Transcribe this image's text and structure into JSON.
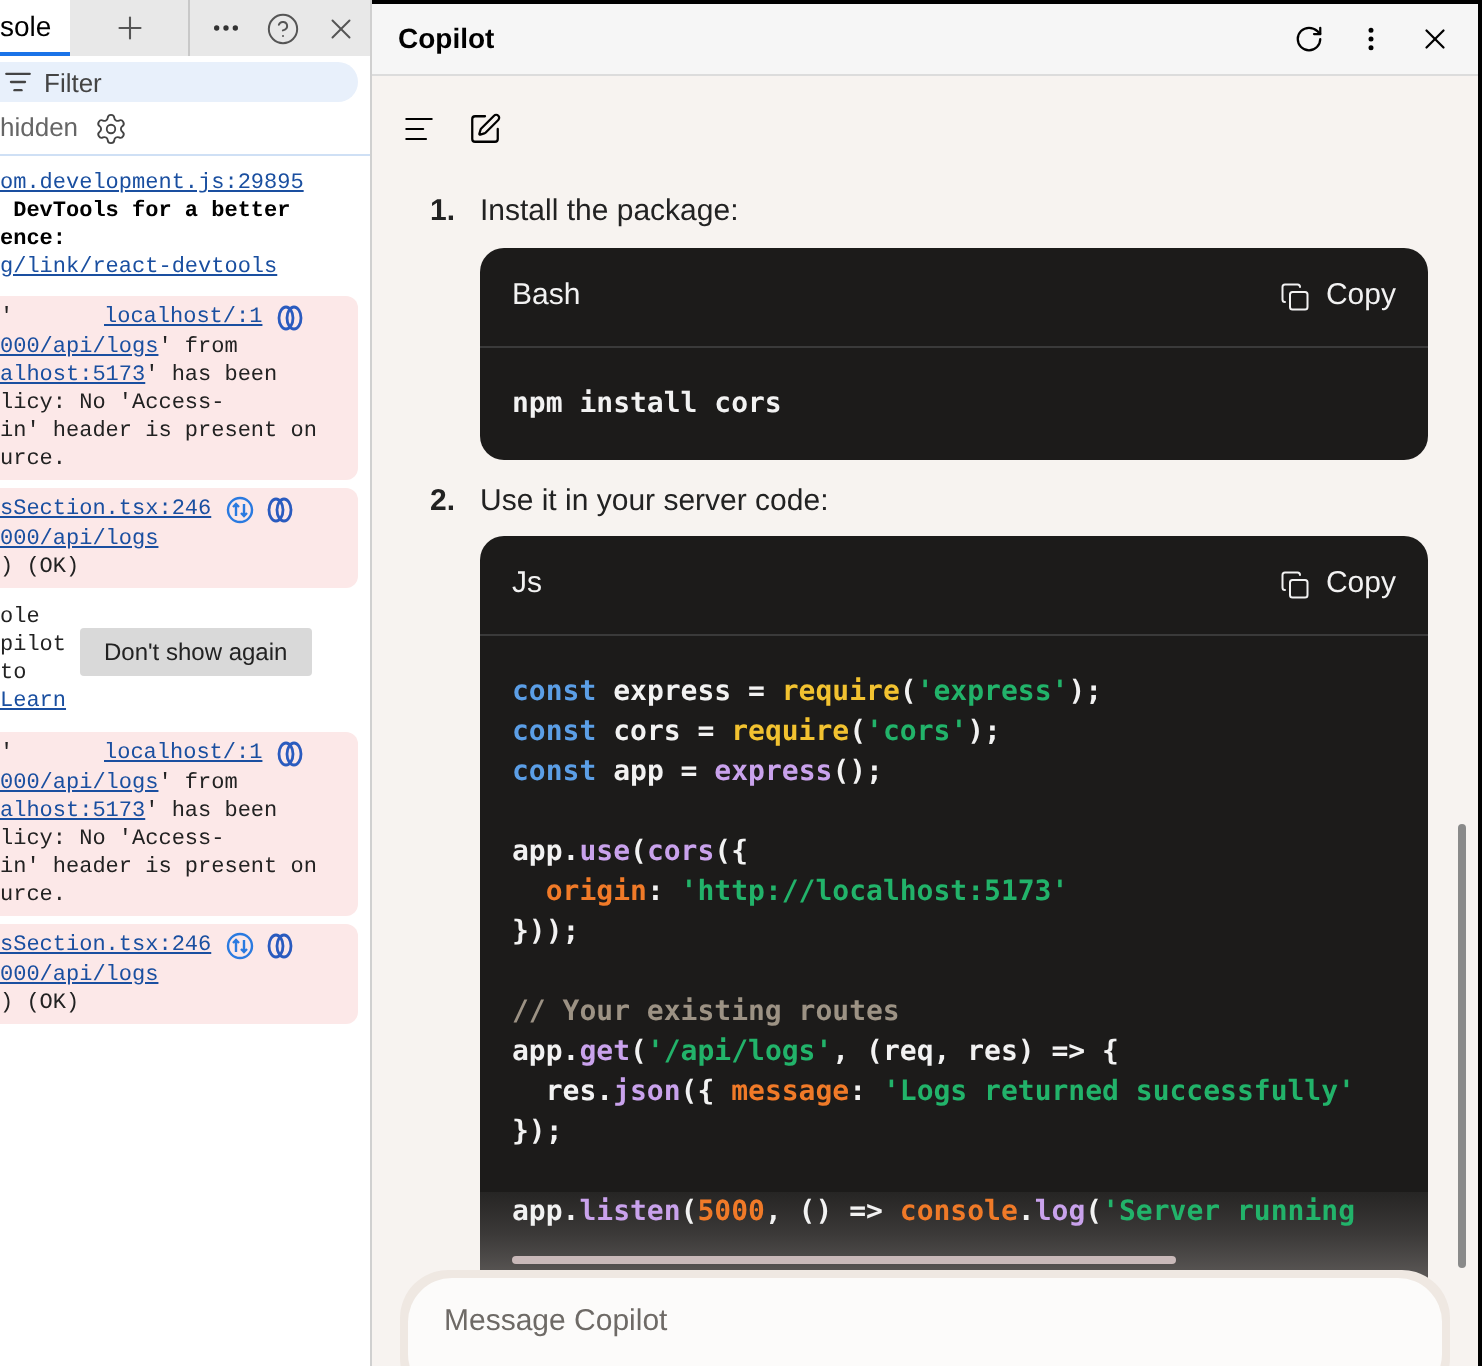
{
  "devtools": {
    "tabs": [
      {
        "label": "sole",
        "selected": true
      }
    ],
    "filter": {
      "placeholder": "Filter"
    },
    "hidden_label": "hidden",
    "messages": [
      {
        "kind": "log",
        "lines": [
          [
            {
              "text": "om.development.js:29895",
              "kind": "link"
            }
          ],
          [
            {
              "text": " DevTools for a better",
              "kind": "strong"
            }
          ],
          [
            {
              "text": "ence:",
              "kind": "strong"
            }
          ],
          [
            {
              "text": "g/link/react-devtools",
              "kind": "link"
            }
          ]
        ]
      },
      {
        "kind": "error",
        "head": "'",
        "source": "localhost/:1",
        "network_icon": false,
        "lines": [
          [
            {
              "text": "000/api/logs",
              "kind": "link"
            },
            {
              "text": "' from",
              "kind": "text"
            }
          ],
          [
            {
              "text": "alhost:5173",
              "kind": "link"
            },
            {
              "text": "' has been",
              "kind": "text"
            }
          ],
          [
            {
              "text": "licy: No 'Access-",
              "kind": "text"
            }
          ],
          [
            {
              "text": "in' header is present on",
              "kind": "text"
            }
          ],
          [
            {
              "text": "urce.",
              "kind": "text"
            }
          ]
        ]
      },
      {
        "kind": "error",
        "source": "sSection.tsx:246",
        "network_icon": true,
        "lines": [
          [
            {
              "text": "000/api/logs",
              "kind": "link"
            }
          ],
          [
            {
              "text": ") (OK)",
              "kind": "text"
            }
          ]
        ]
      },
      {
        "kind": "tip",
        "button": "Don't show again",
        "lines": [
          [
            {
              "text": "ole",
              "kind": "text"
            }
          ],
          [
            {
              "text": "pilot",
              "kind": "text"
            }
          ],
          [
            {
              "text": "to",
              "kind": "text"
            }
          ],
          [
            {
              "text": "Learn",
              "kind": "link"
            }
          ]
        ]
      },
      {
        "kind": "error",
        "head": "'",
        "source": "localhost/:1",
        "network_icon": false,
        "lines": [
          [
            {
              "text": "000/api/logs",
              "kind": "link"
            },
            {
              "text": "' from",
              "kind": "text"
            }
          ],
          [
            {
              "text": "alhost:5173",
              "kind": "link"
            },
            {
              "text": "' has been",
              "kind": "text"
            }
          ],
          [
            {
              "text": "licy: No 'Access-",
              "kind": "text"
            }
          ],
          [
            {
              "text": "in' header is present on",
              "kind": "text"
            }
          ],
          [
            {
              "text": "urce.",
              "kind": "text"
            }
          ]
        ]
      },
      {
        "kind": "error",
        "source": "sSection.tsx:246",
        "network_icon": true,
        "lines": [
          [
            {
              "text": "000/api/logs",
              "kind": "link"
            }
          ],
          [
            {
              "text": ") (OK)",
              "kind": "text"
            }
          ]
        ]
      }
    ]
  },
  "copilot": {
    "title": "Copilot",
    "steps": [
      {
        "number": "1.",
        "text": "Install the package:",
        "code": {
          "language": "Bash",
          "copy": "Copy",
          "paragraphs": [
            [
              [
                {
                  "text": "npm install cors",
                  "kind": "plain"
                }
              ]
            ]
          ]
        }
      },
      {
        "number": "2.",
        "text": "Use it in your server code:",
        "code": {
          "language": "Js",
          "copy": "Copy",
          "paragraphs": [
            [
              [
                {
                  "text": "const",
                  "kind": "keyword"
                },
                {
                  "text": " express = ",
                  "kind": "plain"
                },
                {
                  "text": "require",
                  "kind": "function"
                },
                {
                  "text": "(",
                  "kind": "plain"
                },
                {
                  "text": "'express'",
                  "kind": "string"
                },
                {
                  "text": ");",
                  "kind": "plain"
                }
              ],
              [
                {
                  "text": "const",
                  "kind": "keyword"
                },
                {
                  "text": " cors = ",
                  "kind": "plain"
                },
                {
                  "text": "require",
                  "kind": "function"
                },
                {
                  "text": "(",
                  "kind": "plain"
                },
                {
                  "text": "'cors'",
                  "kind": "string"
                },
                {
                  "text": ");",
                  "kind": "plain"
                }
              ],
              [
                {
                  "text": "const",
                  "kind": "keyword"
                },
                {
                  "text": " app = ",
                  "kind": "plain"
                },
                {
                  "text": "express",
                  "kind": "method"
                },
                {
                  "text": "();",
                  "kind": "plain"
                }
              ]
            ],
            [
              [
                {
                  "text": "app.",
                  "kind": "plain"
                },
                {
                  "text": "use",
                  "kind": "method"
                },
                {
                  "text": "(",
                  "kind": "plain"
                },
                {
                  "text": "cors",
                  "kind": "method"
                },
                {
                  "text": "({",
                  "kind": "plain"
                }
              ],
              [
                {
                  "text": "  origin",
                  "kind": "property"
                },
                {
                  "text": ": ",
                  "kind": "plain"
                },
                {
                  "text": "'http://localhost:5173'",
                  "kind": "string"
                }
              ],
              [
                {
                  "text": "}));",
                  "kind": "plain"
                }
              ]
            ],
            [
              [
                {
                  "text": "// Your existing routes",
                  "kind": "comment"
                }
              ],
              [
                {
                  "text": "app.",
                  "kind": "plain"
                },
                {
                  "text": "get",
                  "kind": "method"
                },
                {
                  "text": "(",
                  "kind": "plain"
                },
                {
                  "text": "'/api/logs'",
                  "kind": "string"
                },
                {
                  "text": ", (req, res) => {",
                  "kind": "plain"
                }
              ],
              [
                {
                  "text": "  res.",
                  "kind": "plain"
                },
                {
                  "text": "json",
                  "kind": "method"
                },
                {
                  "text": "({ ",
                  "kind": "plain"
                },
                {
                  "text": "message",
                  "kind": "property"
                },
                {
                  "text": ": ",
                  "kind": "plain"
                },
                {
                  "text": "'Logs returned successfully'",
                  "kind": "string"
                }
              ],
              [
                {
                  "text": "});",
                  "kind": "plain"
                }
              ]
            ],
            [
              [
                {
                  "text": "app.",
                  "kind": "plain"
                },
                {
                  "text": "listen",
                  "kind": "method"
                },
                {
                  "text": "(",
                  "kind": "plain"
                },
                {
                  "text": "5000",
                  "kind": "property"
                },
                {
                  "text": ", () => ",
                  "kind": "plain"
                },
                {
                  "text": "console",
                  "kind": "property"
                },
                {
                  "text": ".",
                  "kind": "plain"
                },
                {
                  "text": "log",
                  "kind": "method"
                },
                {
                  "text": "(",
                  "kind": "plain"
                },
                {
                  "text": "'Server running",
                  "kind": "string"
                }
              ]
            ]
          ]
        }
      }
    ],
    "input": {
      "placeholder": "Message Copilot"
    }
  }
}
